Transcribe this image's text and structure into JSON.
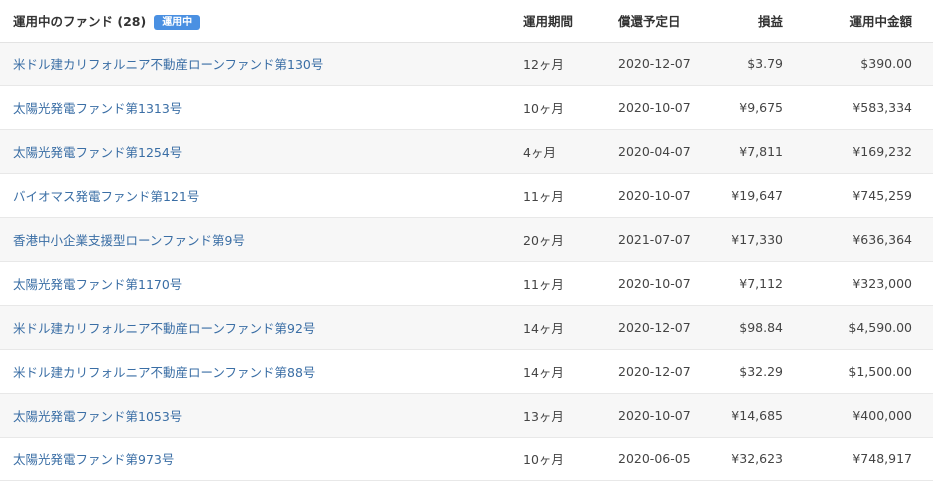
{
  "header": {
    "title": "運用中のファンド (28)",
    "badge": "運用中",
    "col_term": "運用期間",
    "col_date": "償還予定日",
    "col_profit": "損益",
    "col_amount": "運用中金額"
  },
  "rows": [
    {
      "name": "米ドル建カリフォルニア不動産ローンファンド第130号",
      "term": "12ヶ月",
      "date": "2020-12-07",
      "profit": "$3.79",
      "amount": "$390.00"
    },
    {
      "name": "太陽光発電ファンド第1313号",
      "term": "10ヶ月",
      "date": "2020-10-07",
      "profit": "¥9,675",
      "amount": "¥583,334"
    },
    {
      "name": "太陽光発電ファンド第1254号",
      "term": "4ヶ月",
      "date": "2020-04-07",
      "profit": "¥7,811",
      "amount": "¥169,232"
    },
    {
      "name": "バイオマス発電ファンド第121号",
      "term": "11ヶ月",
      "date": "2020-10-07",
      "profit": "¥19,647",
      "amount": "¥745,259"
    },
    {
      "name": "香港中小企業支援型ローンファンド第9号",
      "term": "20ヶ月",
      "date": "2021-07-07",
      "profit": "¥17,330",
      "amount": "¥636,364"
    },
    {
      "name": "太陽光発電ファンド第1170号",
      "term": "11ヶ月",
      "date": "2020-10-07",
      "profit": "¥7,112",
      "amount": "¥323,000"
    },
    {
      "name": "米ドル建カリフォルニア不動産ローンファンド第92号",
      "term": "14ヶ月",
      "date": "2020-12-07",
      "profit": "$98.84",
      "amount": "$4,590.00"
    },
    {
      "name": "米ドル建カリフォルニア不動産ローンファンド第88号",
      "term": "14ヶ月",
      "date": "2020-12-07",
      "profit": "$32.29",
      "amount": "$1,500.00"
    },
    {
      "name": "太陽光発電ファンド第1053号",
      "term": "13ヶ月",
      "date": "2020-10-07",
      "profit": "¥14,685",
      "amount": "¥400,000"
    },
    {
      "name": "太陽光発電ファンド第973号",
      "term": "10ヶ月",
      "date": "2020-06-05",
      "profit": "¥32,623",
      "amount": "¥748,917"
    }
  ],
  "colors": {
    "link": "#3a6ea5",
    "badge": "#4a90e2",
    "row_alt": "#f7f7f7"
  }
}
